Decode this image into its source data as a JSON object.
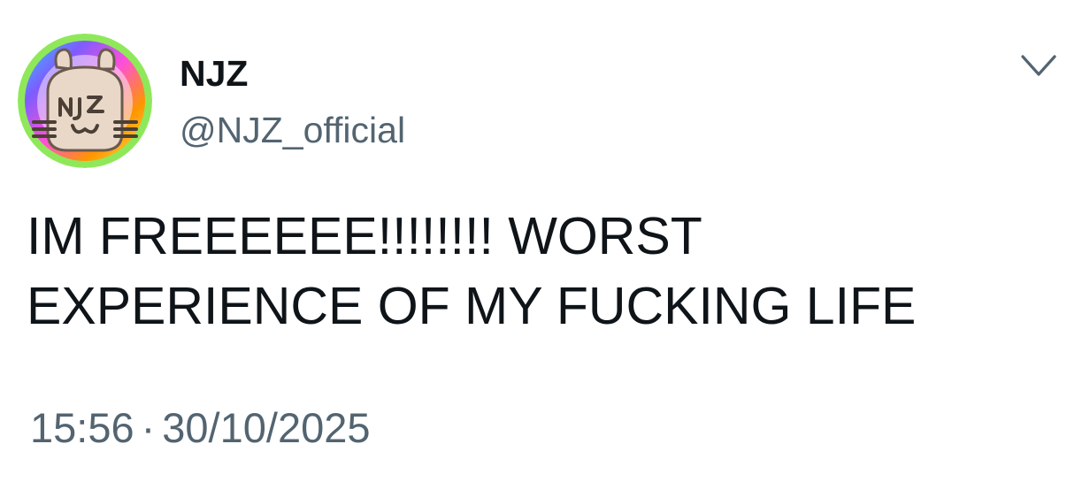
{
  "account": {
    "display_name": "NJZ",
    "handle": "@NJZ_official",
    "avatar_text": "NJZ"
  },
  "tweet": {
    "lines": [
      "IM FREEEEEE!!!!!!!! WORST",
      "EXPERIENCE OF MY FUCKING LIFE"
    ],
    "time": "15:56",
    "separator": "·",
    "date": "30/10/2025"
  },
  "menu": {
    "icon": "chevron-down-icon"
  },
  "colors": {
    "text_primary": "#0f1419",
    "text_secondary": "#536471",
    "avatar_ring": [
      "#ff3b30",
      "#ff9500",
      "#ffe14a",
      "#7ee04a",
      "#33c7ff",
      "#7d5cff",
      "#ff4fd8"
    ]
  }
}
